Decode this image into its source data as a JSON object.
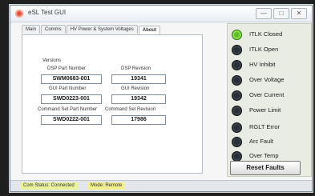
{
  "window": {
    "title": "eSL Test GUI",
    "controls": [
      "—",
      "□",
      "✕"
    ]
  },
  "tabs": [
    "Main",
    "Comms",
    "HV Power & System Voltages",
    "About"
  ],
  "about": {
    "versions_label": "Versions",
    "fields": [
      {
        "label": "DSP Part Number",
        "value": "SWM0683-001"
      },
      {
        "label": "DSP Revision",
        "value": "19341"
      },
      {
        "label": "GUI Part Number",
        "value": "SWD0223-001"
      },
      {
        "label": "GUI Revision",
        "value": "19342"
      },
      {
        "label": "Command Set Part Number",
        "value": "SWD0222-001"
      },
      {
        "label": "Command Set Revision",
        "value": "17986"
      }
    ]
  },
  "indicators": [
    {
      "label": "ITLK Closed",
      "state": "on"
    },
    {
      "label": "ITLK Open",
      "state": "off"
    },
    {
      "label": "HV Inhibit",
      "state": "off"
    },
    {
      "label": "Over Voltage",
      "state": "off"
    },
    {
      "label": "Over Current",
      "state": "off"
    },
    {
      "label": "Power Limit",
      "state": "off"
    },
    {
      "label": "RGLT Error",
      "state": "off"
    },
    {
      "label": "Arc Fault",
      "state": "off"
    },
    {
      "label": "Over Temp",
      "state": "off"
    }
  ],
  "reset_button": "Reset Faults",
  "status": {
    "connection": "Com Status: Connected",
    "mode": "Mode: Remote"
  },
  "colors": {
    "led_on": "#5fbf2a",
    "led_off": "#2a2e36"
  }
}
